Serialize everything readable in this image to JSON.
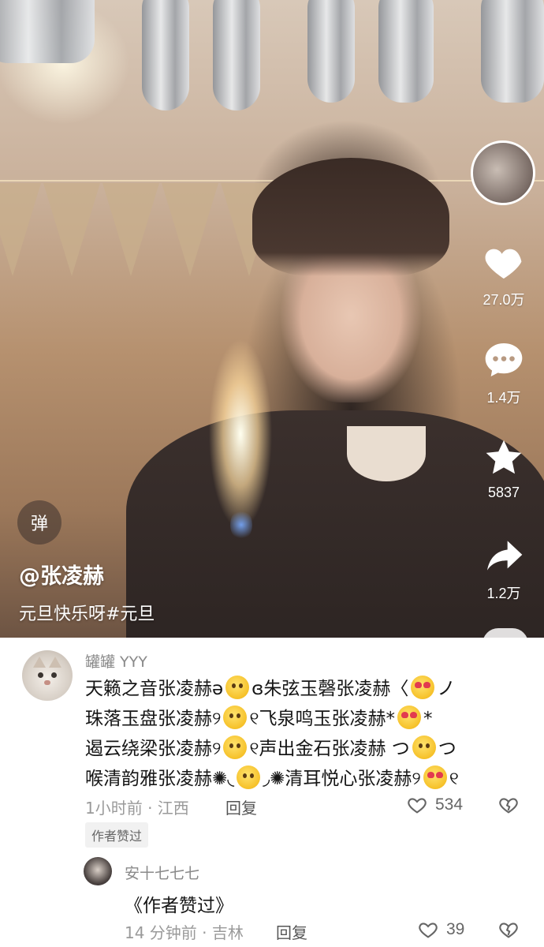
{
  "video": {
    "danmu_label": "弹",
    "author": "@张凌赫",
    "caption": "元旦快乐呀#元旦"
  },
  "actions": {
    "like_count": "27.0万",
    "comment_count": "1.4万",
    "favorite_count": "5837",
    "share_count": "1.2万"
  },
  "comments": [
    {
      "user": "罐罐 YYY",
      "text_parts": [
        "天籁之音张凌赫ə",
        "ɞ朱弦玉磬张凌赫〈",
        "ノ",
        "珠落玉盘张凌赫୨",
        "୧飞泉鸣玉张凌赫*",
        "*",
        "遏云绕梁张凌赫୨",
        "୧声出金石张凌赫 つ",
        "つ",
        "喉清韵雅张凌赫✺◟",
        "◞✺清耳悦心张凌赫୨",
        "୧"
      ],
      "time_location": "1小时前 · 江西",
      "reply_label": "回复",
      "like_count": "534",
      "badge": "作者赞过"
    },
    {
      "user": "安十七七七",
      "text": "《作者赞过》",
      "time_location": "14 分钟前 · 吉林",
      "reply_label": "回复",
      "like_count": "39"
    }
  ],
  "colors": {
    "accent_white": "#ffffff",
    "text_primary": "#161616",
    "text_secondary": "#8a8a8a"
  },
  "icons": [
    "heart-icon",
    "comment-icon",
    "star-icon",
    "share-icon",
    "dislike-icon",
    "danmu-icon"
  ]
}
